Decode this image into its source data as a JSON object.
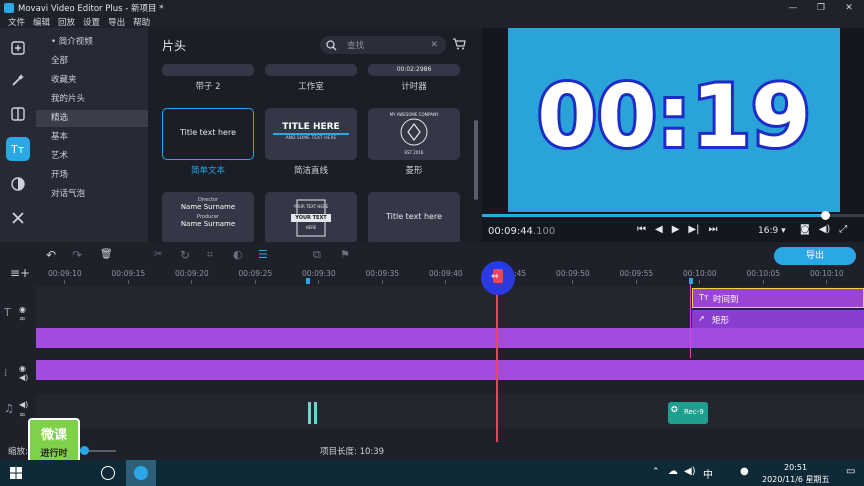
{
  "window": {
    "title": "Movavi Video Editor Plus - 新项目 *",
    "min": "—",
    "max": "❐",
    "close": "✕"
  },
  "menu": [
    "文件",
    "编辑",
    "回放",
    "设置",
    "导出",
    "帮助"
  ],
  "tools": [
    "import-icon",
    "magic-icon",
    "filter-icon",
    "titles-icon",
    "transition-icon",
    "more-tools-icon"
  ],
  "categories": [
    {
      "label": "• 简介视频",
      "selected": false
    },
    {
      "label": "全部",
      "selected": false
    },
    {
      "label": "收藏夹",
      "selected": false
    },
    {
      "label": "我的片头",
      "selected": false
    },
    {
      "label": "精选",
      "selected": true
    },
    {
      "label": "基本",
      "selected": false
    },
    {
      "label": "艺术",
      "selected": false
    },
    {
      "label": "开场",
      "selected": false
    },
    {
      "label": "对话气泡",
      "selected": false
    }
  ],
  "gallery": {
    "heading": "片头",
    "search_placeholder": "查找",
    "top_labels": [
      "带子 2",
      "工作室",
      "计时器"
    ],
    "timer_text": "00:02:2986",
    "cards": [
      {
        "label": "简单文本",
        "text": "Title text here",
        "selected": true
      },
      {
        "label": "简洁直线",
        "line1": "TITLE HERE",
        "line2": "AND SOME TEXT HERE",
        "selected": false
      },
      {
        "label": "菱形",
        "badge_top": "MY AWESOME COMPANY",
        "badge_bottom": "EST 2016",
        "selected": false
      }
    ],
    "cards_bottom": [
      {
        "l1": "Director",
        "l2": "Name Surname",
        "l3": "Producer",
        "l4": "Name Surname"
      },
      {
        "ribbon": "YOUR TEXT",
        "top": "YOUR TEXT HERE",
        "bottom": "HERE"
      },
      {
        "text": "Title text here"
      }
    ]
  },
  "preview": {
    "bg_color": "#2aa4d8",
    "big_text": "00:19",
    "time_main": "00:09:44",
    "time_ms": ".100",
    "aspect": "16:9 ▾",
    "progress": 0.9
  },
  "toolbar": {
    "export_label": "导出"
  },
  "ruler": [
    "00:09:10",
    "00:09:15",
    "00:09:20",
    "00:09:25",
    "00:09:30",
    "00:09:35",
    "00:09:40",
    "00:09:45",
    "00:09:50",
    "00:09:55",
    "00:10:00",
    "00:10:05",
    "00:10:10"
  ],
  "clips": {
    "title1": "时间到",
    "title2": "矩形",
    "audio": "Rec-9"
  },
  "status": {
    "zoom_label": "缩放:",
    "duration_label": "项目长度: 10:39"
  },
  "watermark": {
    "line1": "微课",
    "line2": "进行时"
  },
  "taskbar": {
    "time": "20:51",
    "date": "2020/11/6 星期五",
    "ime": "中"
  }
}
